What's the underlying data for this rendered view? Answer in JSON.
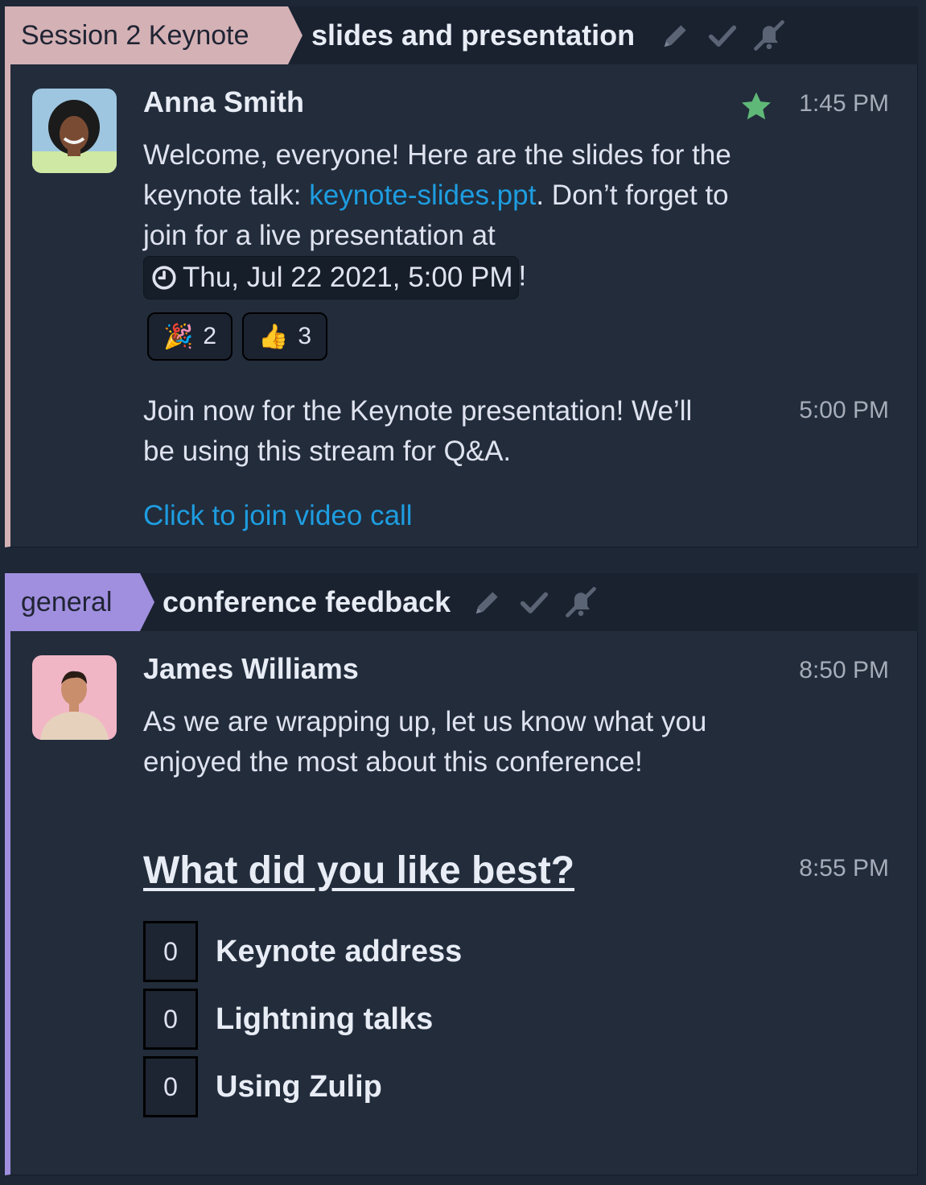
{
  "recipient_blocks": [
    {
      "stream": "Session 2 Keynote",
      "stream_color": "#d4b1b5",
      "topic": "slides and presentation",
      "topic_icons": [
        "edit-pencil-icon",
        "resolve-check-icon",
        "mute-bell-icon"
      ],
      "messages": [
        {
          "sender": "Anna Smith",
          "avatar": "avatar-anna-smith",
          "time": "1:45 PM",
          "starred": true,
          "text_before_link": "Welcome, everyone! Here are the slides for the keynote talk: ",
          "link_text": "keynote-slides.ppt",
          "text_after_link": ". Don’t forget to join for a live presentation at ",
          "time_mention": "Thu, Jul 22 2021, 5:00 PM",
          "text_end": "!",
          "reactions": [
            {
              "emoji": "🎉",
              "emoji_name": "tada",
              "count": "2"
            },
            {
              "emoji": "👍",
              "emoji_name": "thumbs-up",
              "count": "3"
            }
          ]
        },
        {
          "time": "5:00 PM",
          "text": "Join now for the Keynote presentation! We’ll be using this stream for Q&A.",
          "video_link": "Click to join video call"
        }
      ]
    },
    {
      "stream": "general",
      "stream_color": "#a08fdf",
      "topic": "conference feedback",
      "topic_icons": [
        "edit-pencil-icon",
        "resolve-check-icon",
        "mute-bell-icon"
      ],
      "messages": [
        {
          "sender": "James Williams",
          "avatar": "avatar-james-williams",
          "time": "8:50 PM",
          "text": "As we are wrapping up, let us know what you enjoyed the most about this conference!"
        },
        {
          "time": "8:55 PM",
          "poll": {
            "question": "What did you like best?",
            "options": [
              {
                "count": "0",
                "label": "Keynote address"
              },
              {
                "count": "0",
                "label": "Lightning talks"
              },
              {
                "count": "0",
                "label": "Using Zulip"
              }
            ]
          }
        }
      ]
    }
  ],
  "colors": {
    "background": "#1d2735",
    "message_background": "#222c3b",
    "header_background": "#1a2230",
    "link": "#1e9de0",
    "star": "#5fb877",
    "muted_text": "#a6acb8"
  }
}
